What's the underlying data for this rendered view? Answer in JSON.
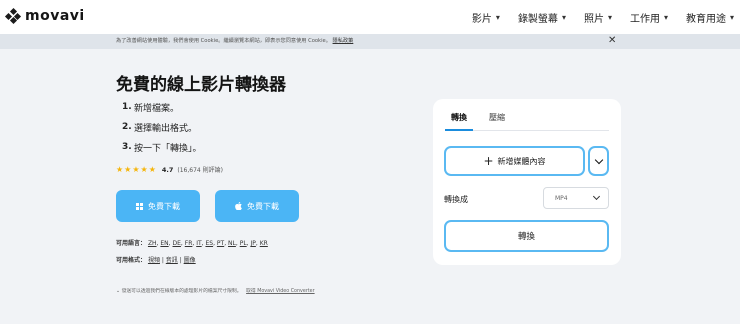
{
  "header": {
    "logo_text": "movavi",
    "nav": [
      {
        "label": "影片"
      },
      {
        "label": "錄製螢幕"
      },
      {
        "label": "照片"
      },
      {
        "label": "工作用"
      },
      {
        "label": "教育用途"
      }
    ]
  },
  "cookie_bar": {
    "text": "為了改善網站使用體驗，我們會使用 Cookie。繼續瀏覽本網站，即表示您同意使用 Cookie。",
    "link": "隱私政策"
  },
  "main": {
    "title": "免費的線上影片轉換器",
    "steps": [
      {
        "num": "1.",
        "text": "新增檔案。"
      },
      {
        "num": "2.",
        "text": "選擇輸出格式。"
      },
      {
        "num": "3.",
        "text": "按一下「轉換」。"
      }
    ],
    "rating": {
      "stars": "★★★★★",
      "score": "4.7",
      "count": "(16,674 則評論)"
    },
    "download_windows": "免費下載",
    "download_mac": "免費下載",
    "languages": {
      "label": "可用語言：",
      "items": [
        "ZH",
        "EN",
        "DE",
        "FR",
        "IT",
        "ES",
        "PT",
        "NL",
        "PL",
        "JP",
        "KR"
      ]
    },
    "formats": {
      "label": "可用格式：",
      "items": [
        "視頻",
        "音訊",
        "圖像"
      ]
    },
    "footnote": {
      "text": "發送可以透過我們在線版本的處理影片的檔案尺寸限制。",
      "link": "取得 Movavi Video Converter"
    }
  },
  "converter": {
    "tabs": [
      {
        "label": "轉換"
      },
      {
        "label": "壓縮"
      }
    ],
    "add_media": "新增媒體內容",
    "convert_to_label": "轉換成",
    "format_value": "MP4",
    "convert_button": "轉換"
  }
}
